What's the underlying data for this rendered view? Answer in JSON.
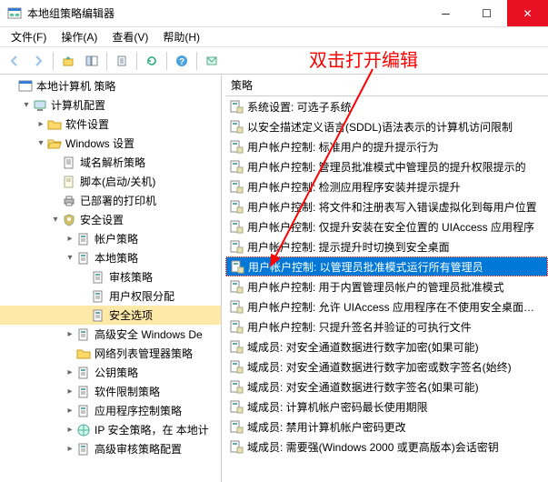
{
  "window": {
    "title": "本地组策略编辑器"
  },
  "menubar": [
    "文件(F)",
    "操作(A)",
    "查看(V)",
    "帮助(H)"
  ],
  "annotation": "双击打开编辑",
  "list_header": "策略",
  "tree": [
    {
      "indent": 0,
      "toggle": "",
      "icon": "gpedit",
      "label": "本地计算机 策略"
    },
    {
      "indent": 1,
      "toggle": "▾",
      "icon": "computer",
      "label": "计算机配置"
    },
    {
      "indent": 2,
      "toggle": "▸",
      "icon": "folder",
      "label": "软件设置"
    },
    {
      "indent": 2,
      "toggle": "▾",
      "icon": "folder-open",
      "label": "Windows 设置"
    },
    {
      "indent": 3,
      "toggle": "",
      "icon": "page",
      "label": "域名解析策略"
    },
    {
      "indent": 3,
      "toggle": "",
      "icon": "script",
      "label": "脚本(启动/关机)"
    },
    {
      "indent": 3,
      "toggle": "",
      "icon": "printer",
      "label": "已部署的打印机"
    },
    {
      "indent": 3,
      "toggle": "▾",
      "icon": "shield",
      "label": "安全设置"
    },
    {
      "indent": 4,
      "toggle": "▸",
      "icon": "policy",
      "label": "帐户策略"
    },
    {
      "indent": 4,
      "toggle": "▾",
      "icon": "policy",
      "label": "本地策略"
    },
    {
      "indent": 5,
      "toggle": "",
      "icon": "policy",
      "label": "审核策略"
    },
    {
      "indent": 5,
      "toggle": "",
      "icon": "policy",
      "label": "用户权限分配"
    },
    {
      "indent": 5,
      "toggle": "",
      "icon": "policy",
      "label": "安全选项",
      "selected_bg": true
    },
    {
      "indent": 4,
      "toggle": "▸",
      "icon": "policy",
      "label": "高级安全 Windows De"
    },
    {
      "indent": 4,
      "toggle": "",
      "icon": "folder",
      "label": "网络列表管理器策略"
    },
    {
      "indent": 4,
      "toggle": "▸",
      "icon": "policy",
      "label": "公钥策略"
    },
    {
      "indent": 4,
      "toggle": "▸",
      "icon": "policy",
      "label": "软件限制策略"
    },
    {
      "indent": 4,
      "toggle": "▸",
      "icon": "policy",
      "label": "应用程序控制策略"
    },
    {
      "indent": 4,
      "toggle": "▸",
      "icon": "ipsec",
      "label": "IP 安全策略，在 本地计"
    },
    {
      "indent": 4,
      "toggle": "▸",
      "icon": "policy",
      "label": "高级审核策略配置"
    }
  ],
  "list": [
    {
      "label": "系统设置: 可选子系统"
    },
    {
      "label": "以安全描述定义语言(SDDL)语法表示的计算机访问限制"
    },
    {
      "label": "用户帐户控制: 标准用户的提升提示行为"
    },
    {
      "label": "用户帐户控制: 管理员批准模式中管理员的提升权限提示的"
    },
    {
      "label": "用户帐户控制: 检测应用程序安装并提示提升"
    },
    {
      "label": "用户帐户控制: 将文件和注册表写入错误虚拟化到每用户位置"
    },
    {
      "label": "用户帐户控制: 仅提升安装在安全位置的 UIAccess 应用程序"
    },
    {
      "label": "用户帐户控制: 提示提升时切换到安全桌面"
    },
    {
      "label": "用户帐户控制: 以管理员批准模式运行所有管理员",
      "selected": true
    },
    {
      "label": "用户帐户控制: 用于内置管理员帐户的管理员批准模式"
    },
    {
      "label": "用户帐户控制: 允许 UIAccess 应用程序在不使用安全桌面…"
    },
    {
      "label": "用户帐户控制: 只提升签名并验证的可执行文件"
    },
    {
      "label": "域成员: 对安全通道数据进行数字加密(如果可能)"
    },
    {
      "label": "域成员: 对安全通道数据进行数字加密或数字签名(始终)"
    },
    {
      "label": "域成员: 对安全通道数据进行数字签名(如果可能)"
    },
    {
      "label": "域成员: 计算机帐户密码最长使用期限"
    },
    {
      "label": "域成员: 禁用计算机帐户密码更改"
    },
    {
      "label": "域成员: 需要强(Windows 2000 或更高版本)会话密钥"
    }
  ]
}
